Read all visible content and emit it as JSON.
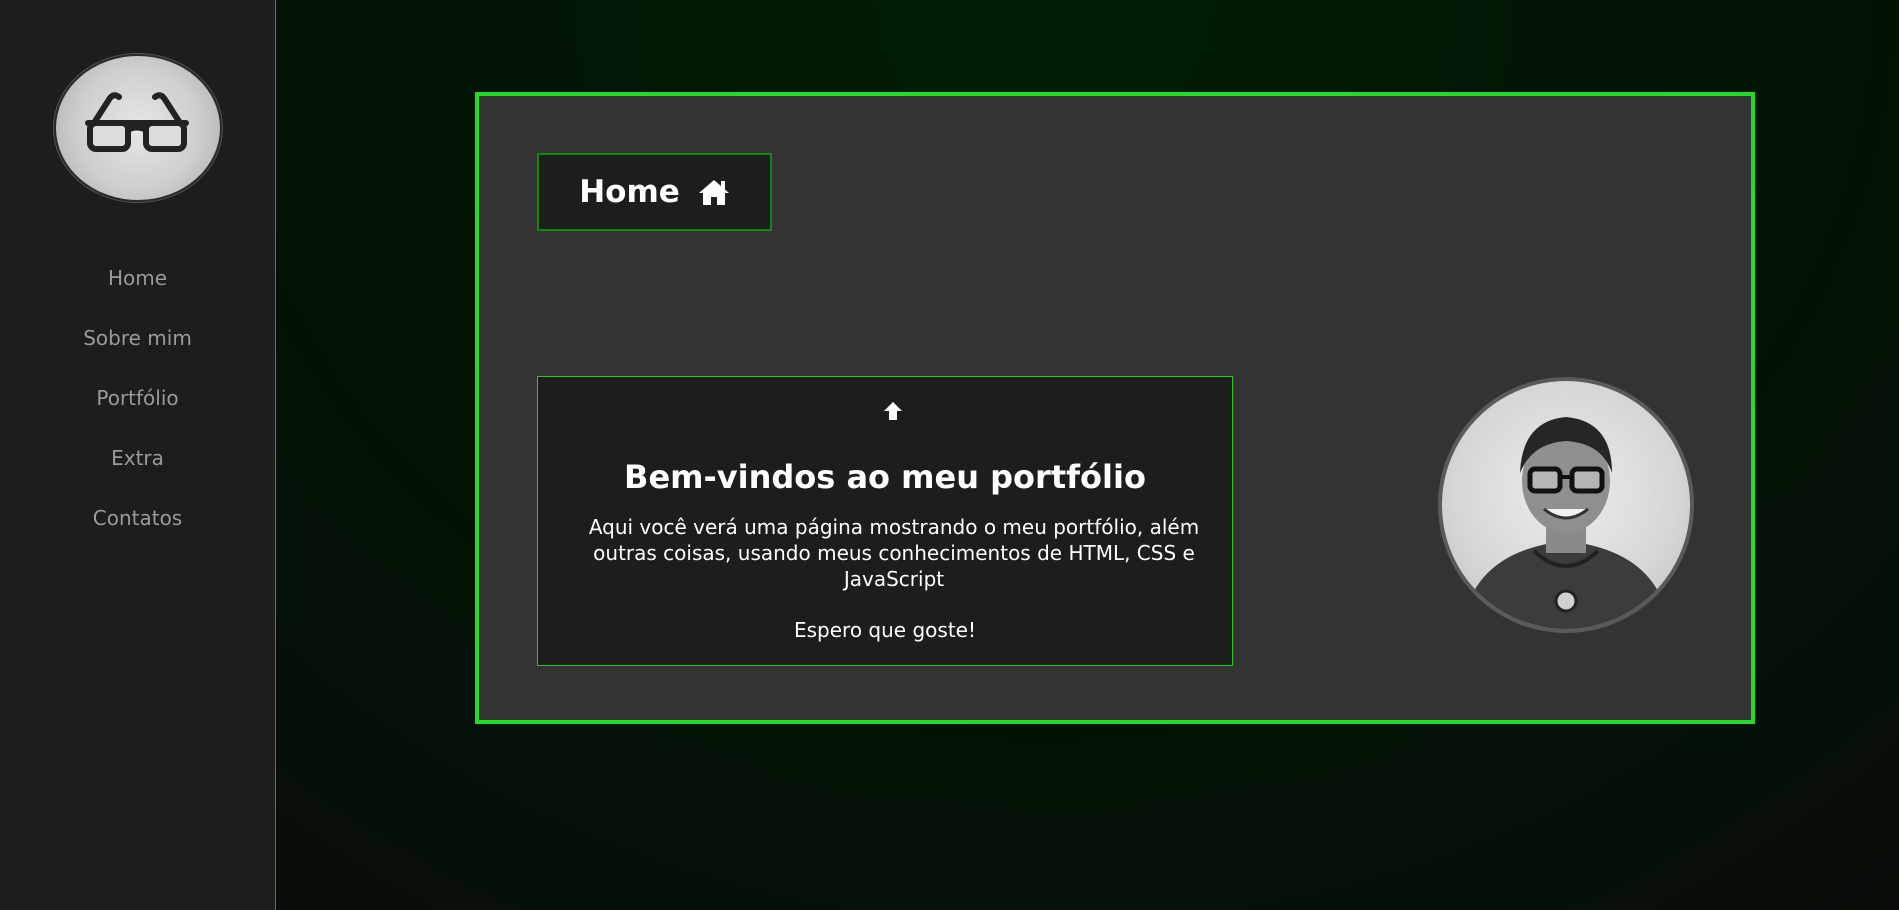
{
  "sidebar": {
    "logo_icon": "glasses-icon",
    "nav": [
      {
        "label": "Home"
      },
      {
        "label": "Sobre mim"
      },
      {
        "label": "Portfólio"
      },
      {
        "label": "Extra"
      },
      {
        "label": "Contatos"
      }
    ]
  },
  "page": {
    "title": "Home",
    "title_icon": "home-icon"
  },
  "welcome": {
    "arrow_icon": "arrow-up-icon",
    "heading": "Bem-vindos ao meu portfólio",
    "description": "Aqui você verá uma página mostrando o meu portfólio, além outras coisas, usando meus conhecimentos de HTML, CSS e JavaScript",
    "closing": "Espero que goste!"
  },
  "profile": {
    "photo_icon": "profile-photo"
  },
  "colors": {
    "accent": "#22dd22",
    "sidebar_bg": "#1d1d1d",
    "card_bg": "#333333",
    "nav_text": "#9a9a9a"
  }
}
